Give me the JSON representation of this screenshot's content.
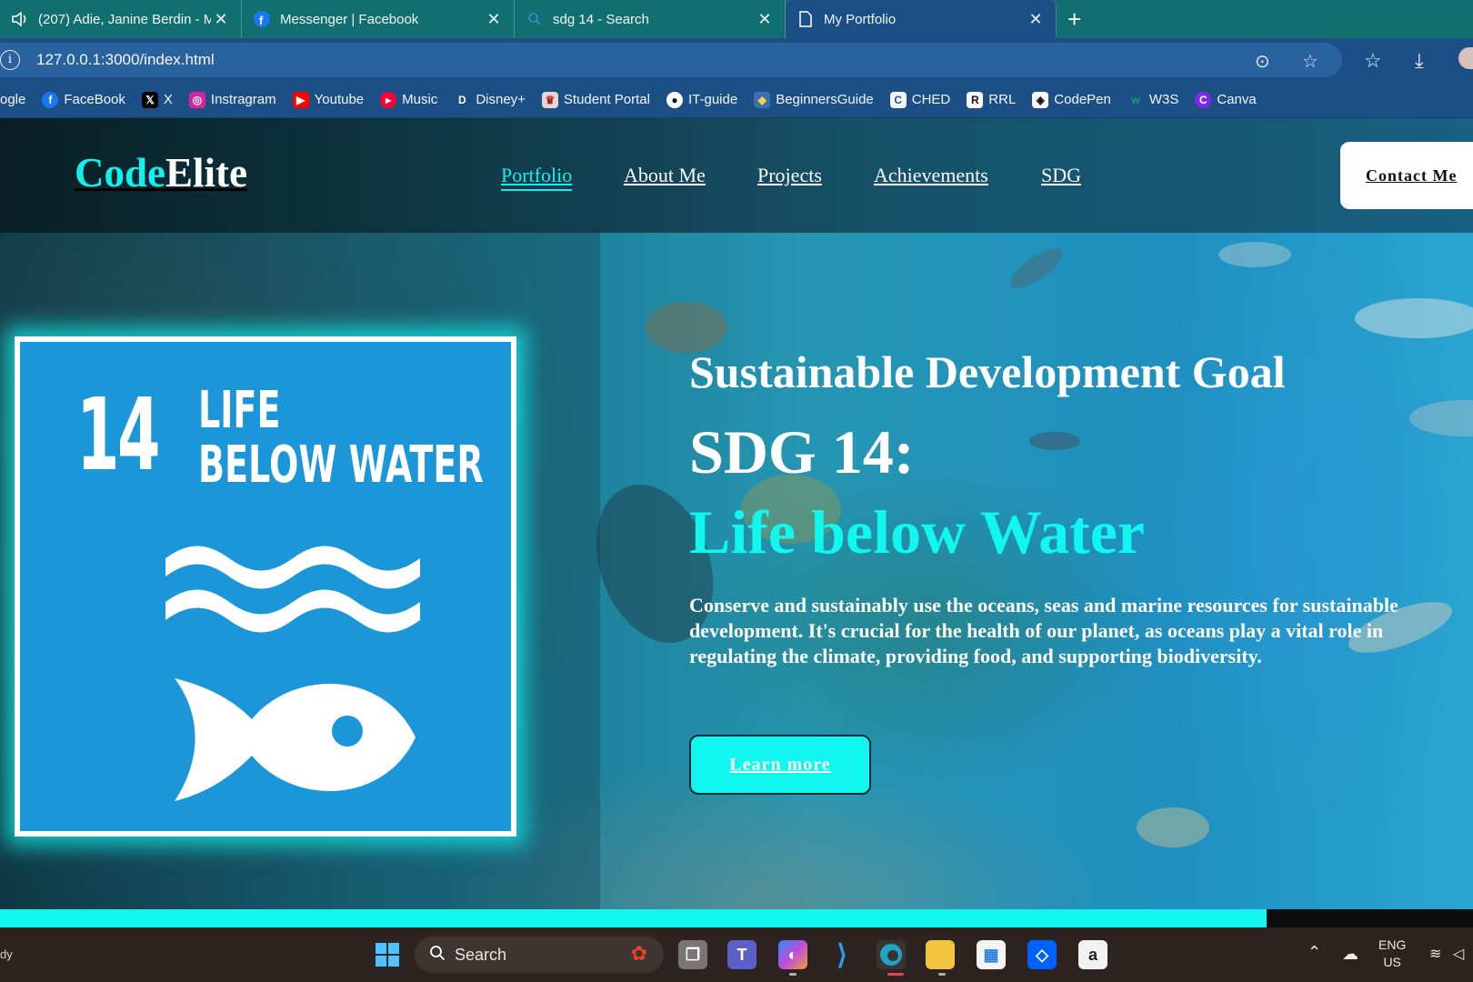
{
  "browser": {
    "tabs": [
      {
        "title": "(207) Adie, Janine Berdin - M",
        "icon": "speaker-icon",
        "active": false
      },
      {
        "title": "Messenger | Facebook",
        "icon": "facebook-icon",
        "active": false
      },
      {
        "title": "sdg 14 - Search",
        "icon": "search-icon",
        "active": false
      },
      {
        "title": "My Portfolio",
        "icon": "page-icon",
        "active": true
      }
    ],
    "url": "127.0.0.1:3000/index.html",
    "bookmarks": [
      "ogle",
      "FaceBook",
      "X",
      "Instragram",
      "Youtube",
      "Music",
      "Disney+",
      "Student Portal",
      "IT-guide",
      "BeginnersGuide",
      "CHED",
      "RRL",
      "CodePen",
      "W3S",
      "Canva"
    ]
  },
  "site": {
    "logo": {
      "part1": "Code",
      "part2": "Elite"
    },
    "nav": [
      "Portfolio",
      "About Me",
      "Projects",
      "Achievements",
      "SDG"
    ],
    "contact": "Contact Me",
    "sdg_tile": {
      "number": "14",
      "line1": "LIFE",
      "line2": "BELOW WATER"
    },
    "hero": {
      "subtitle": "Sustainable Development Goal",
      "title": "SDG 14:",
      "title2": "Life below Water",
      "description": "Conserve and sustainably use the oceans, seas and marine resources for sustainable development. It's crucial for the health of our planet, as oceans play a vital role in regulating the climate, providing food, and supporting biodiversity.",
      "button": "Learn more"
    },
    "scroll_progress": 0.86
  },
  "taskbar": {
    "left_text": "dy",
    "search": "Search",
    "lang1": "ENG",
    "lang2": "US"
  },
  "colors": {
    "accent": "#12f6f0",
    "sdg_blue": "#1a96d9",
    "chrome": "#1c4f86",
    "tabbar": "#11706f"
  }
}
